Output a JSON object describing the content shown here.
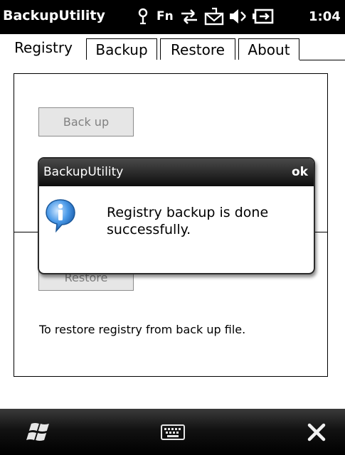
{
  "title_bar": {
    "app_title": "BackupUtility",
    "fn_label": "Fn",
    "clock": "1:04",
    "icons": [
      "antenna-icon",
      "sync-icon",
      "message-icon",
      "speaker-off-icon",
      "battery-charging-icon"
    ]
  },
  "tabs": [
    {
      "label": "Registry",
      "active": true
    },
    {
      "label": "Backup",
      "active": false
    },
    {
      "label": "Restore",
      "active": false
    },
    {
      "label": "About",
      "active": false
    }
  ],
  "registry_panel": {
    "backup_button": "Back up",
    "restore_button": "Restore",
    "restore_description": "To restore registry from back up file."
  },
  "message_box": {
    "title": "BackupUtility",
    "ok_label": "ok",
    "icon": "info-icon",
    "message": "Registry backup is done successfully."
  },
  "bottom_bar": {
    "icons": [
      "windows-start-icon",
      "keyboard-icon",
      "close-icon"
    ]
  },
  "colors": {
    "title_bar_bg": "#000000",
    "button_disabled_text": "#808080",
    "info_icon_blue": "#2f7fd0"
  }
}
